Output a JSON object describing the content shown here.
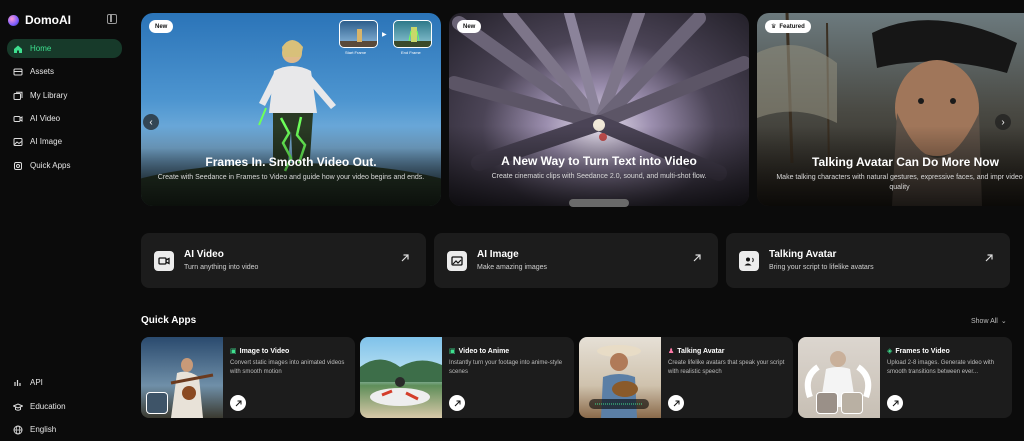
{
  "brand": {
    "name": "DomoAI"
  },
  "sidebar": {
    "items": [
      {
        "label": "Home",
        "icon": "home-icon"
      },
      {
        "label": "Assets",
        "icon": "assets-icon"
      },
      {
        "label": "My Library",
        "icon": "library-icon"
      },
      {
        "label": "AI Video",
        "icon": "video-icon"
      },
      {
        "label": "AI Image",
        "icon": "image-icon"
      },
      {
        "label": "Quick Apps",
        "icon": "apps-icon"
      }
    ],
    "footer": [
      {
        "label": "API",
        "icon": "api-icon"
      },
      {
        "label": "Education",
        "icon": "education-icon"
      },
      {
        "label": "English",
        "icon": "globe-icon"
      }
    ]
  },
  "banners": [
    {
      "tag": "New",
      "title": "Frames In. Smooth Video Out.",
      "desc": "Create with Seedance in Frames to Video and guide how your video begins and ends.",
      "start_label": "Start Frame",
      "end_label": "End Frame"
    },
    {
      "tag": "New",
      "title": "A New Way to Turn Text into Video",
      "desc": "Create cinematic clips with Seedance 2.0, sound, and multi-shot flow."
    },
    {
      "tag": "Featured",
      "title": "Talking Avatar Can Do More Now",
      "desc": "Make talking characters with natural gestures, expressive faces, and impr video quality"
    }
  ],
  "features": [
    {
      "title": "AI Video",
      "desc": "Turn anything into video"
    },
    {
      "title": "AI Image",
      "desc": "Make amazing images"
    },
    {
      "title": "Talking Avatar",
      "desc": "Bring your script to lifelike avatars"
    }
  ],
  "quick_apps": {
    "title": "Quick Apps",
    "show_all": "Show All",
    "items": [
      {
        "name": "Image to Video",
        "desc": "Convert static images into animated videos with smooth motion",
        "accent": "#3ee08f"
      },
      {
        "name": "Video to Anime",
        "desc": "Instantly turn your footage into anime-style scenes",
        "accent": "#3ee08f"
      },
      {
        "name": "Talking Avatar",
        "desc": "Create lifelike avatars that speak your script with realistic speech",
        "accent": "#ff7aa8"
      },
      {
        "name": "Frames to Video",
        "desc": "Upload 2-8 images. Generate video with smooth transitions between ever...",
        "accent": "#3ee08f"
      }
    ]
  },
  "colors": {
    "accent": "#3ee08f",
    "active_bg": "#173a2a",
    "card_bg": "#1c1c1c"
  }
}
